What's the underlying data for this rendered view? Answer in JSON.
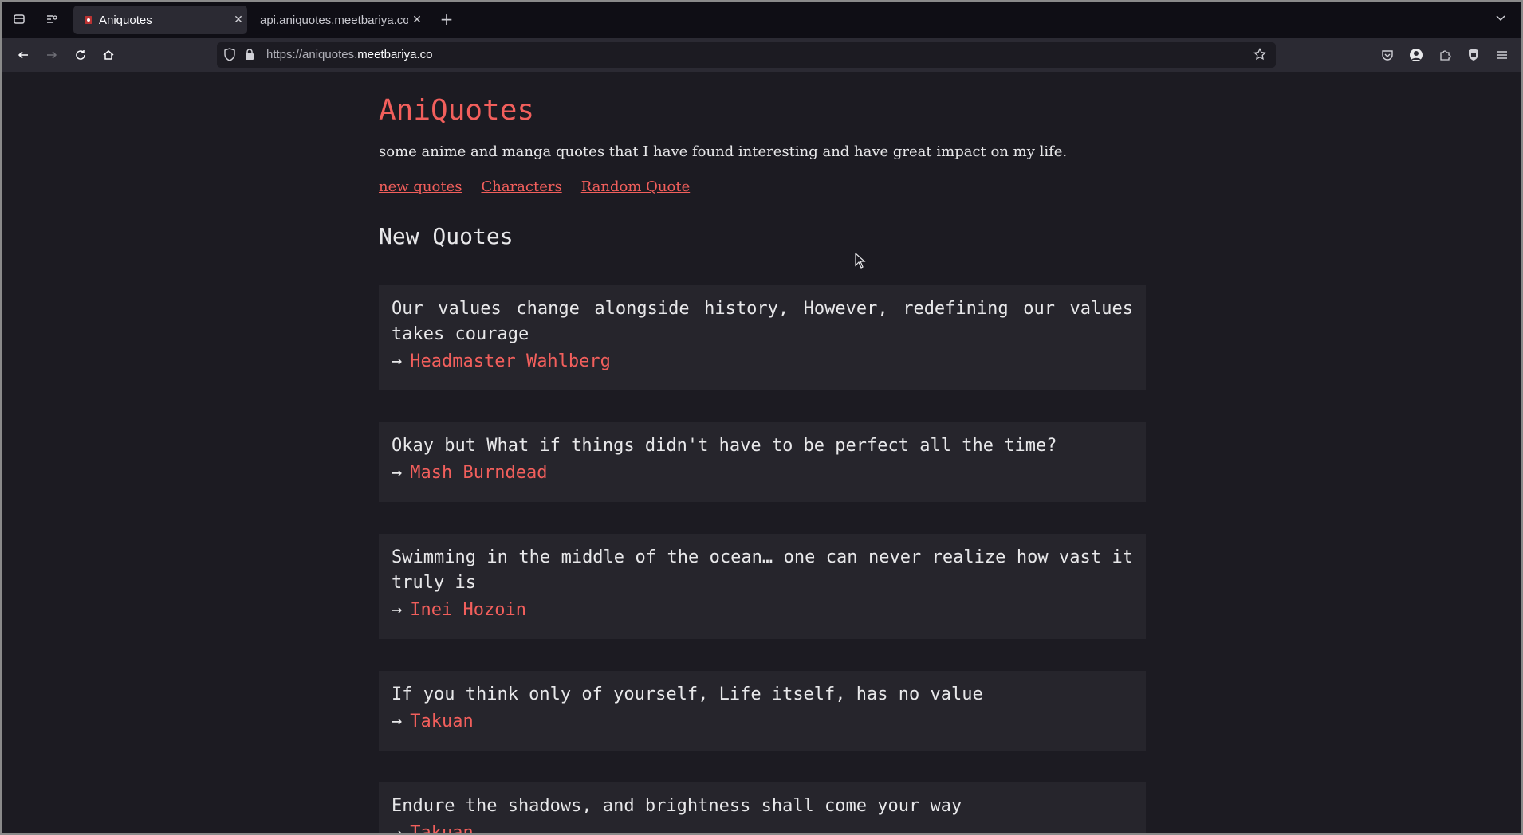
{
  "browser": {
    "tabs": [
      {
        "title": "Aniquotes",
        "active": true
      },
      {
        "title": "api.aniquotes.meetbariya.co/",
        "active": false
      }
    ],
    "url": {
      "prefix": "https://aniquotes.",
      "host": "meetbariya.co"
    }
  },
  "site": {
    "title": "AniQuotes",
    "description": "some anime and manga quotes that I have found interesting and have great impact on my life.",
    "nav": {
      "new_quotes": "new quotes",
      "characters": "Characters",
      "random": "Random Quote"
    },
    "section_title": "New Quotes",
    "arrow": "→",
    "quotes": [
      {
        "text": "Our values change alongside history, However, redefining our values takes courage",
        "author": "Headmaster Wahlberg"
      },
      {
        "text": "Okay but What if things didn't have to be perfect all the time?",
        "author": "Mash Burndead"
      },
      {
        "text": "Swimming in the middle of the ocean… one can never realize how vast it truly is",
        "author": "Inei Hozoin"
      },
      {
        "text": "If you think only of yourself, Life itself, has no value",
        "author": "Takuan"
      },
      {
        "text": "Endure the shadows, and brightness shall come your way",
        "author": "Takuan"
      }
    ]
  },
  "colors": {
    "accent": "#f25f5c",
    "background": "#1c1b22",
    "card": "#26252c"
  }
}
